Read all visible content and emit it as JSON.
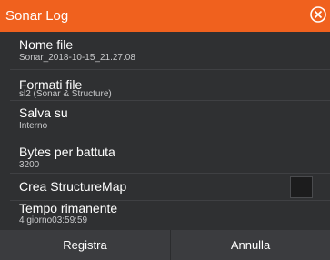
{
  "dialog": {
    "title": "Sonar Log",
    "close_icon": "close-circle-icon"
  },
  "rows": [
    {
      "label": "Nome file",
      "value": "Sonar_2018-10-15_21.27.08"
    },
    {
      "label": "Formati file",
      "value": "sl2 (Sonar & Structure)"
    },
    {
      "label": "Salva su",
      "value": "Interno"
    },
    {
      "label": "Bytes per battuta",
      "value": "3200"
    },
    {
      "label": "Crea StructureMap",
      "checked": false
    },
    {
      "label": "Tempo rimanente",
      "value": "4 giorno03:59:59"
    }
  ],
  "buttons": {
    "record": "Registra",
    "cancel": "Annulla"
  },
  "colors": {
    "accent": "#f0611e",
    "background": "#2f3032",
    "button_bar": "#3b3c3f"
  }
}
